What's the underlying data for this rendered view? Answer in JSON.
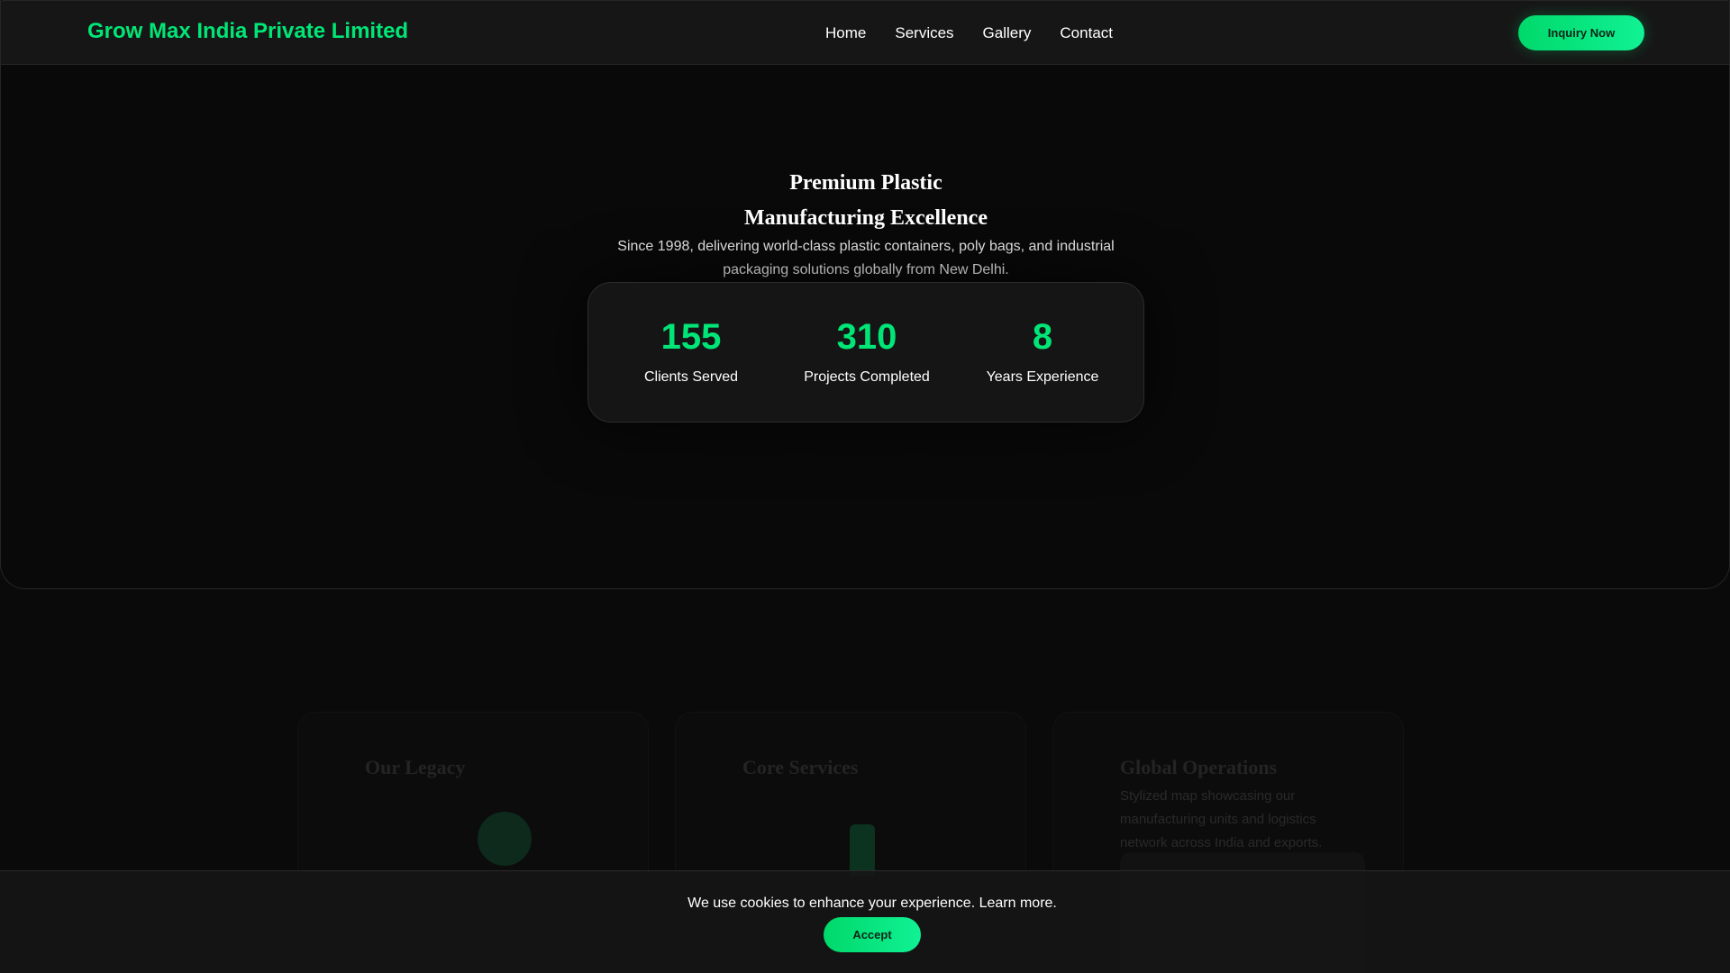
{
  "brand": {
    "name": "Grow Max India Private Limited"
  },
  "nav": {
    "links": [
      "Home",
      "Services",
      "Gallery",
      "Contact"
    ],
    "cta_label": "Inquiry Now"
  },
  "hero": {
    "title_line1": "Premium Plastic",
    "title_line2": "Manufacturing Excellence",
    "subtitle": "Since 1998, delivering world-class plastic containers, poly bags, and industrial packaging solutions globally from New Delhi."
  },
  "stats": [
    {
      "value": "155",
      "label": "Clients Served"
    },
    {
      "value": "310",
      "label": "Projects Completed"
    },
    {
      "value": "8",
      "label": "Years Experience"
    }
  ],
  "features": {
    "legacy_title": "Our Legacy",
    "services_title": "Core Services",
    "global_title": "Global Operations",
    "global_desc": "Stylized map showcasing our manufacturing units and logistics network across India and exports."
  },
  "cookie": {
    "message": "We use cookies to enhance your experience.",
    "learn_more": "Learn more.",
    "accept_label": "Accept"
  },
  "colors": {
    "accent": "#00e676",
    "background": "#0a0a0a",
    "surface": "#161616"
  }
}
